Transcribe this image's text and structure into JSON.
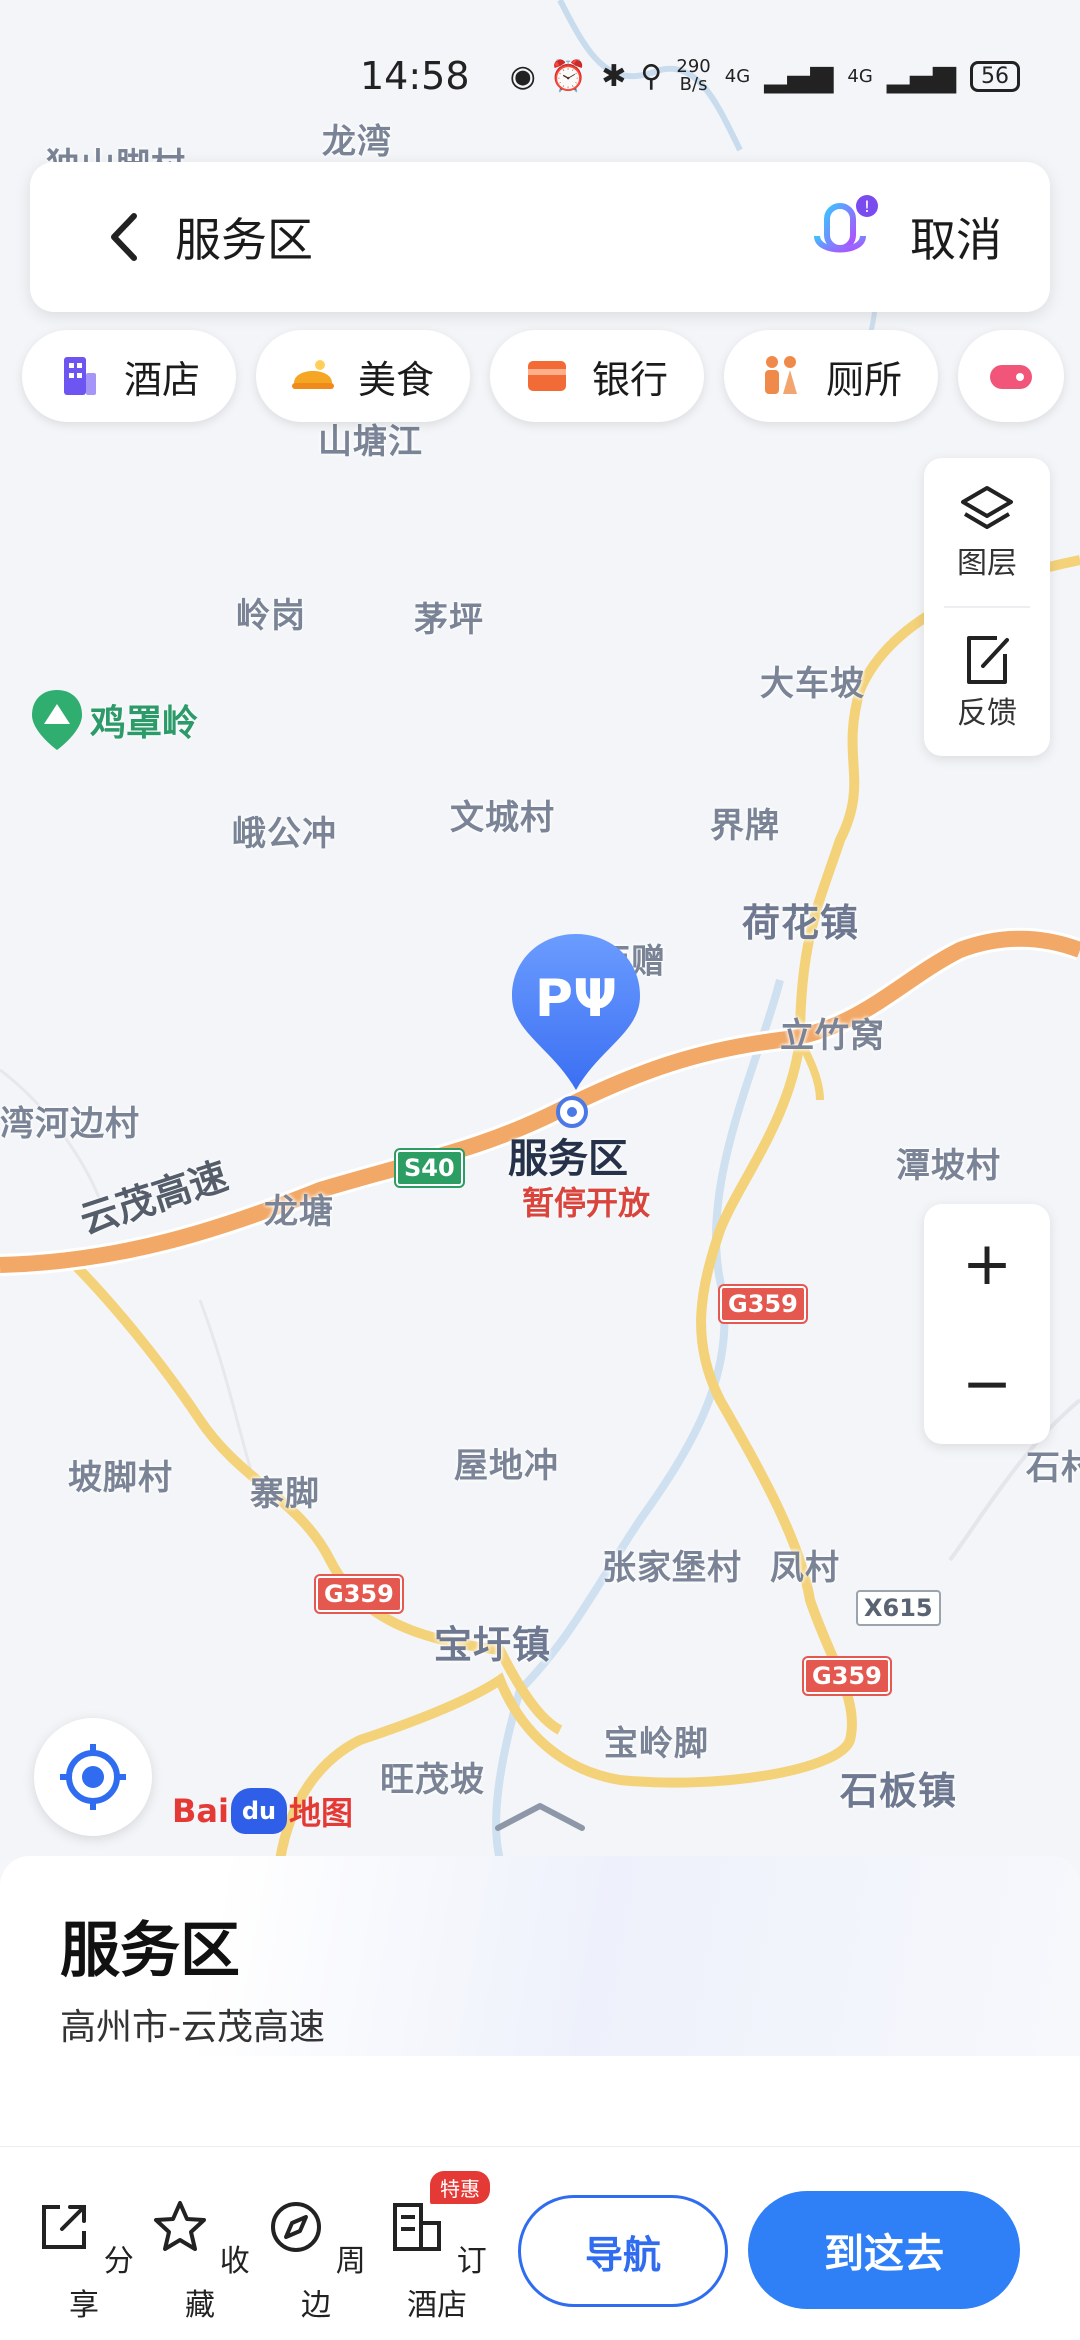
{
  "status_bar": {
    "time": "14:58",
    "net_speed_top": "290",
    "net_speed_unit": "B/s",
    "signal1": "4G",
    "signal2": "4G",
    "battery": "56"
  },
  "search": {
    "back_icon": "back-chevron-icon",
    "query": "服务区",
    "mic_icon": "voice-assistant-icon",
    "cancel_label": "取消"
  },
  "categories": [
    {
      "label": "酒店",
      "icon": "hotel-icon",
      "color": "#6c55f0"
    },
    {
      "label": "美食",
      "icon": "food-icon",
      "color": "#f5a623"
    },
    {
      "label": "银行",
      "icon": "bank-icon",
      "color": "#f26a36"
    },
    {
      "label": "厕所",
      "icon": "toilet-icon",
      "color": "#f08a4b"
    }
  ],
  "map_controls": {
    "layers_label": "图层",
    "feedback_label": "反馈",
    "zoom_in": "+",
    "zoom_out": "−"
  },
  "map_labels": {
    "places": [
      "龙湾",
      "独山脚村",
      "山塘江",
      "岭岗",
      "茅坪",
      "大车坡",
      "界牌",
      "文城村",
      "峨公冲",
      "荷花镇",
      "立竹窝",
      "潭坡村",
      "龙塘",
      "坡脚村",
      "寨脚",
      "屋地冲",
      "张家堡村",
      "凤村",
      "宝圩镇",
      "宝岭脚",
      "旺茂坡",
      "石板镇",
      "湾河边村",
      "西赠",
      "石村"
    ],
    "poi_green": "鸡罩岭",
    "highway": "云茂高速",
    "shields": [
      "S40",
      "G359",
      "G359",
      "G359",
      "X615"
    ]
  },
  "poi": {
    "name": "服务区",
    "status": "暂停开放",
    "marker_glyph": "PΨ"
  },
  "brand": {
    "logo_left": "Bai",
    "logo_mid": "du",
    "logo_right": "地图"
  },
  "sheet": {
    "title": "服务区",
    "address": "高州市-云茂高速",
    "actions": [
      {
        "label": "分享",
        "icon": "share-icon"
      },
      {
        "label": "收藏",
        "icon": "star-icon"
      },
      {
        "label": "周边",
        "icon": "compass-icon"
      },
      {
        "label": "订酒店",
        "icon": "hotel-booking-icon"
      }
    ],
    "badge": "特惠",
    "nav_label": "导航",
    "go_label": "到这去"
  }
}
